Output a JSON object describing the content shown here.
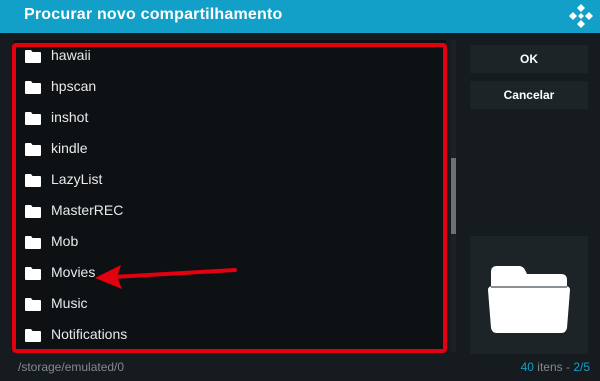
{
  "dialog": {
    "title": "Procurar novo compartilhamento"
  },
  "file_list": {
    "items": [
      {
        "label": "hawaii",
        "icon": "folder-icon"
      },
      {
        "label": "hpscan",
        "icon": "folder-icon"
      },
      {
        "label": "inshot",
        "icon": "folder-icon"
      },
      {
        "label": "kindle",
        "icon": "folder-icon"
      },
      {
        "label": "LazyList",
        "icon": "folder-icon"
      },
      {
        "label": "MasterREC",
        "icon": "folder-icon"
      },
      {
        "label": "Mob",
        "icon": "folder-icon"
      },
      {
        "label": "Movies",
        "icon": "folder-icon"
      },
      {
        "label": "Music",
        "icon": "folder-icon"
      },
      {
        "label": "Notifications",
        "icon": "folder-icon"
      }
    ]
  },
  "buttons": {
    "ok_label": "OK",
    "cancel_label": "Cancelar"
  },
  "footer": {
    "path": "/storage/emulated/0",
    "count": "40",
    "items_word": " itens - ",
    "page": "2/5"
  },
  "annotation": {
    "highlight_color": "#e4000f",
    "arrow_target": "Movies"
  },
  "colors": {
    "accent": "#12a0c9",
    "background": "#151b1e",
    "list_background": "#0d1113",
    "button_background": "#1c2427"
  }
}
